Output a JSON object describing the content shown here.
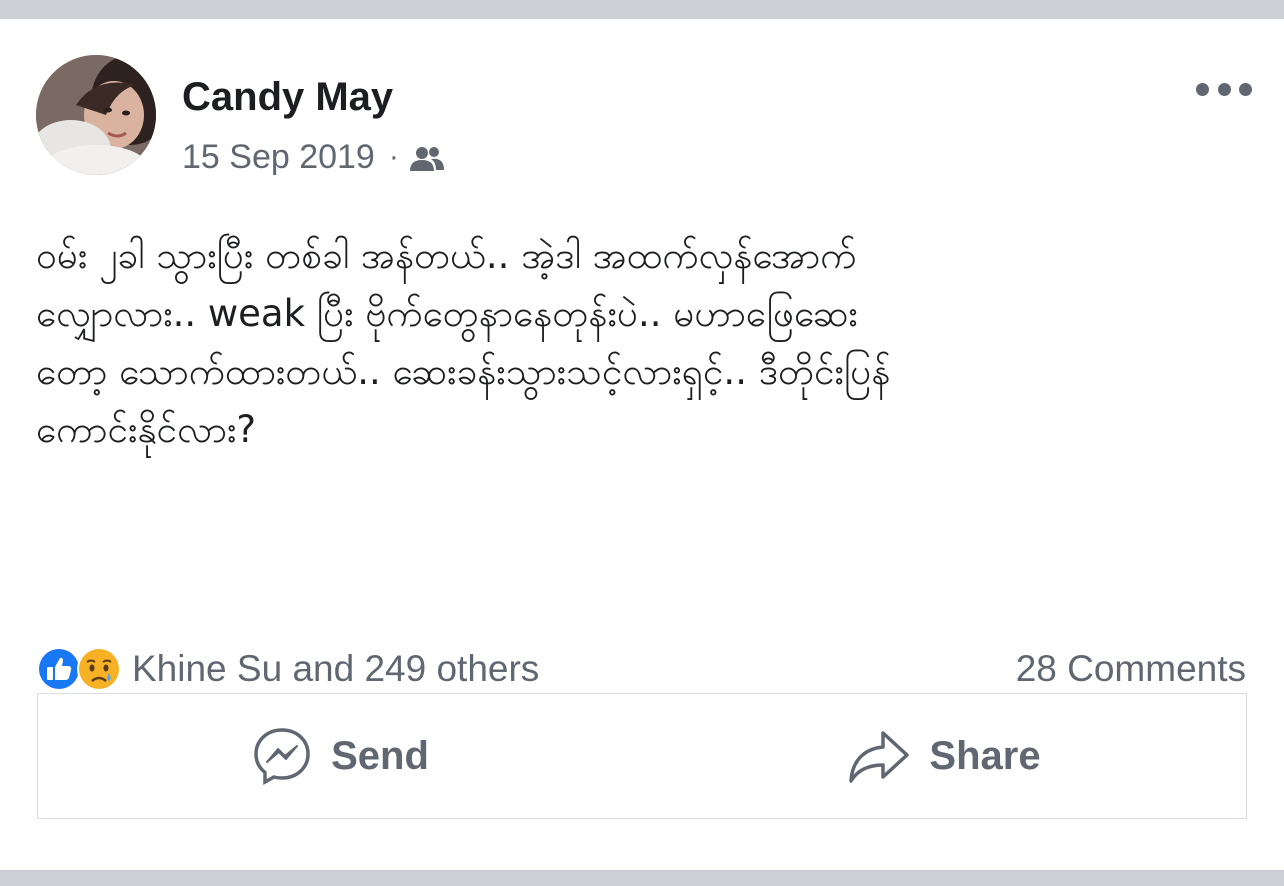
{
  "post": {
    "author": "Candy May",
    "date": "15 Sep 2019",
    "separator": "·",
    "privacy_icon": "friends-icon",
    "text_lines": [
      "ဝမ်း ၂ခါ သွားပြီး တစ်ခါ အန်တယ်.. အဲ့ဒါ အထက်လှန်အောက်",
      "လျှောလား.. weak ပြီး ဗိုက်တွေနာနေတုန်းပဲ..  မဟာဖြေဆေး",
      "တော့ သောက်ထားတယ်.. ဆေးခန်းသွားသင့်လားရှင့်.. ဒီတိုင်းပြန်",
      "ကောင်းနိုင်လား?"
    ]
  },
  "reactions": {
    "icons": [
      "like-icon",
      "sad-icon"
    ],
    "summary": "Khine Su and 249 others",
    "comments": "28 Comments"
  },
  "actions": {
    "send_label": "Send",
    "send_icon": "messenger-icon",
    "share_label": "Share",
    "share_icon": "share-arrow-icon"
  },
  "colors": {
    "text": "#1c1e21",
    "secondary": "#606770",
    "like_blue": "#1877f2",
    "sad_yellow": "#f7b125",
    "background": "#ccd0d5"
  }
}
